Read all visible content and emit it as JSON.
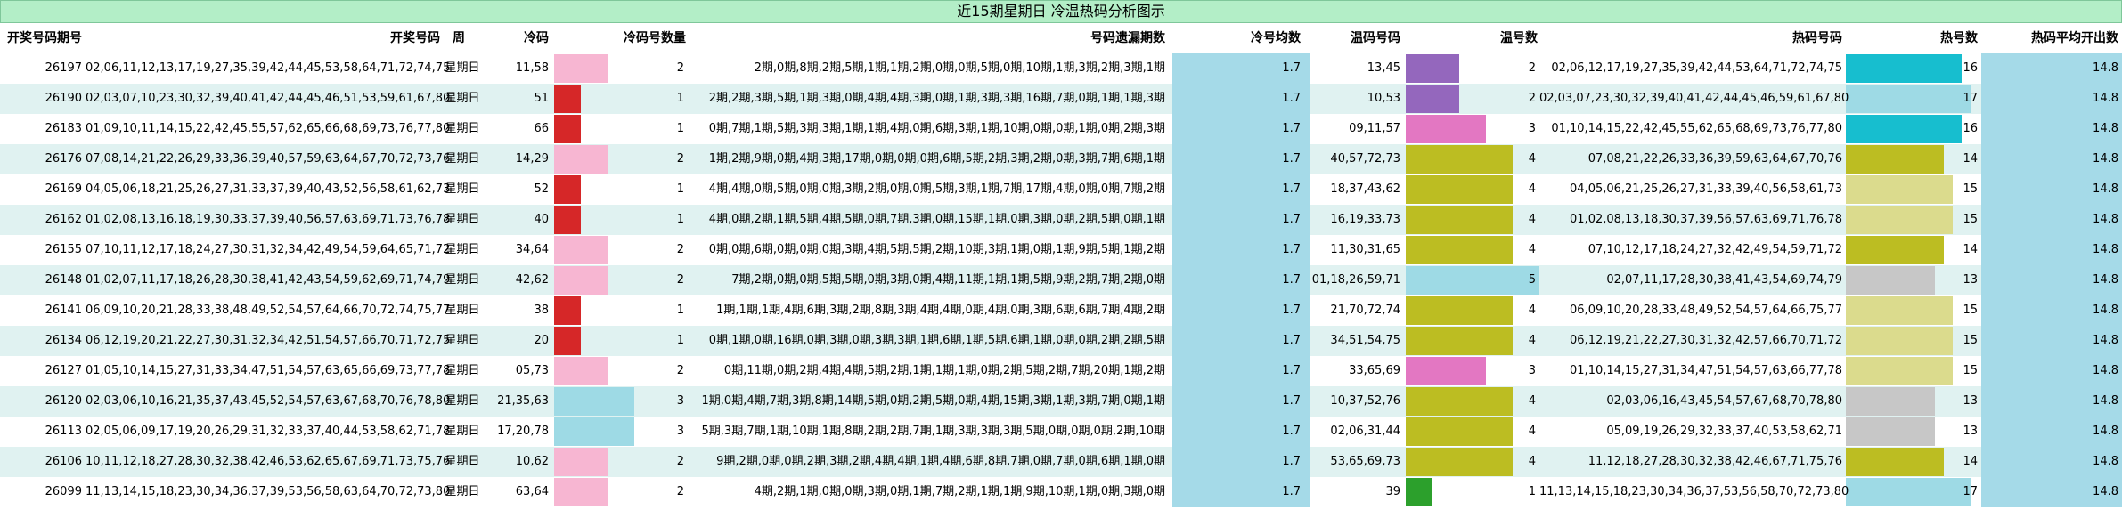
{
  "title": "近15期星期日 冷温热码分析图示",
  "headers": {
    "period": "开奖号码期号",
    "numbers": "开奖号码",
    "week": "周",
    "cold": "冷码",
    "cold_count": "冷码号数量",
    "missing": "号码遗漏期数",
    "cold_avg": "冷号均数",
    "warm": "温码号码",
    "warm_count": "温号数",
    "hot": "热码号码",
    "hot_count": "热号数",
    "hot_avg": "热码平均开出数"
  },
  "colors": {
    "title_bg": "#b3eec7",
    "row_alt": "#e0f2f1",
    "avg_block": "#a5dae8",
    "cold_1": "#d62728",
    "cold_2": "#f7b6d2",
    "cold_3": "#9edae5",
    "warm_1": "#2ca02c",
    "warm_2": "#9467bd",
    "warm_3": "#e377c2",
    "warm_4": "#bcbd22",
    "warm_5": "#9edae5",
    "hot_13": "#c7c7c7",
    "hot_14": "#bcbd22",
    "hot_15": "#dbdb8d",
    "hot_16": "#17becf",
    "hot_17": "#9edae5"
  },
  "rows": [
    {
      "period": "26197",
      "numbers": "02,06,11,12,13,17,19,27,35,39,42,44,45,53,58,64,71,72,74,75",
      "week": "星期日",
      "cold": "11,58",
      "cold_count": "2",
      "missing": "2期,0期,8期,2期,5期,1期,1期,2期,0期,0期,5期,0期,10期,1期,3期,2期,3期,1期",
      "cold_avg": "1.7",
      "warm": "13,45",
      "warm_count": "2",
      "hot": "02,06,12,17,19,27,35,39,42,44,53,64,71,72,74,75",
      "hot_count": "16",
      "hot_avg": "14.8"
    },
    {
      "period": "26190",
      "numbers": "02,03,07,10,23,30,32,39,40,41,42,44,45,46,51,53,59,61,67,80",
      "week": "星期日",
      "cold": "51",
      "cold_count": "1",
      "missing": "2期,2期,3期,5期,1期,3期,0期,4期,4期,3期,0期,1期,3期,3期,16期,7期,0期,1期,1期,3期",
      "cold_avg": "1.7",
      "warm": "10,53",
      "warm_count": "2",
      "hot": "02,03,07,23,30,32,39,40,41,42,44,45,46,59,61,67,80",
      "hot_count": "17",
      "hot_avg": "14.8"
    },
    {
      "period": "26183",
      "numbers": "01,09,10,11,14,15,22,42,45,55,57,62,65,66,68,69,73,76,77,80",
      "week": "星期日",
      "cold": "66",
      "cold_count": "1",
      "missing": "0期,7期,1期,5期,3期,3期,1期,1期,4期,0期,6期,3期,1期,10期,0期,0期,1期,0期,2期,3期",
      "cold_avg": "1.7",
      "warm": "09,11,57",
      "warm_count": "3",
      "hot": "01,10,14,15,22,42,45,55,62,65,68,69,73,76,77,80",
      "hot_count": "16",
      "hot_avg": "14.8"
    },
    {
      "period": "26176",
      "numbers": "07,08,14,21,22,26,29,33,36,39,40,57,59,63,64,67,70,72,73,76",
      "week": "星期日",
      "cold": "14,29",
      "cold_count": "2",
      "missing": "1期,2期,9期,0期,4期,3期,17期,0期,0期,0期,6期,5期,2期,3期,2期,0期,3期,7期,6期,1期",
      "cold_avg": "1.7",
      "warm": "40,57,72,73",
      "warm_count": "4",
      "hot": "07,08,21,22,26,33,36,39,59,63,64,67,70,76",
      "hot_count": "14",
      "hot_avg": "14.8"
    },
    {
      "period": "26169",
      "numbers": "04,05,06,18,21,25,26,27,31,33,37,39,40,43,52,56,58,61,62,73",
      "week": "星期日",
      "cold": "52",
      "cold_count": "1",
      "missing": "4期,4期,0期,5期,0期,0期,3期,2期,0期,0期,5期,3期,1期,7期,17期,4期,0期,0期,7期,2期",
      "cold_avg": "1.7",
      "warm": "18,37,43,62",
      "warm_count": "4",
      "hot": "04,05,06,21,25,26,27,31,33,39,40,56,58,61,73",
      "hot_count": "15",
      "hot_avg": "14.8"
    },
    {
      "period": "26162",
      "numbers": "01,02,08,13,16,18,19,30,33,37,39,40,56,57,63,69,71,73,76,78",
      "week": "星期日",
      "cold": "40",
      "cold_count": "1",
      "missing": "4期,0期,2期,1期,5期,4期,5期,0期,7期,3期,0期,15期,1期,0期,3期,0期,2期,5期,0期,1期",
      "cold_avg": "1.7",
      "warm": "16,19,33,73",
      "warm_count": "4",
      "hot": "01,02,08,13,18,30,37,39,56,57,63,69,71,76,78",
      "hot_count": "15",
      "hot_avg": "14.8"
    },
    {
      "period": "26155",
      "numbers": "07,10,11,12,17,18,24,27,30,31,32,34,42,49,54,59,64,65,71,72",
      "week": "星期日",
      "cold": "34,64",
      "cold_count": "2",
      "missing": "0期,0期,6期,0期,0期,0期,3期,4期,5期,5期,2期,10期,3期,1期,0期,1期,9期,5期,1期,2期",
      "cold_avg": "1.7",
      "warm": "11,30,31,65",
      "warm_count": "4",
      "hot": "07,10,12,17,18,24,27,32,42,49,54,59,71,72",
      "hot_count": "14",
      "hot_avg": "14.8"
    },
    {
      "period": "26148",
      "numbers": "01,02,07,11,17,18,26,28,30,38,41,42,43,54,59,62,69,71,74,79",
      "week": "星期日",
      "cold": "42,62",
      "cold_count": "2",
      "missing": "7期,2期,0期,0期,5期,5期,0期,3期,0期,4期,11期,1期,1期,5期,9期,2期,7期,2期,0期",
      "cold_avg": "1.7",
      "warm": "01,18,26,59,71",
      "warm_count": "5",
      "hot": "02,07,11,17,28,30,38,41,43,54,69,74,79",
      "hot_count": "13",
      "hot_avg": "14.8"
    },
    {
      "period": "26141",
      "numbers": "06,09,10,20,21,28,33,38,48,49,52,54,57,64,66,70,72,74,75,77",
      "week": "星期日",
      "cold": "38",
      "cold_count": "1",
      "missing": "1期,1期,1期,4期,6期,3期,2期,8期,3期,4期,4期,0期,4期,0期,3期,6期,6期,7期,4期,2期",
      "cold_avg": "1.7",
      "warm": "21,70,72,74",
      "warm_count": "4",
      "hot": "06,09,10,20,28,33,48,49,52,54,57,64,66,75,77",
      "hot_count": "15",
      "hot_avg": "14.8"
    },
    {
      "period": "26134",
      "numbers": "06,12,19,20,21,22,27,30,31,32,34,42,51,54,57,66,70,71,72,75",
      "week": "星期日",
      "cold": "20",
      "cold_count": "1",
      "missing": "0期,1期,0期,16期,0期,3期,0期,3期,3期,1期,6期,1期,5期,6期,1期,0期,0期,2期,2期,5期",
      "cold_avg": "1.7",
      "warm": "34,51,54,75",
      "warm_count": "4",
      "hot": "06,12,19,21,22,27,30,31,32,42,57,66,70,71,72",
      "hot_count": "15",
      "hot_avg": "14.8"
    },
    {
      "period": "26127",
      "numbers": "01,05,10,14,15,27,31,33,34,47,51,54,57,63,65,66,69,73,77,78",
      "week": "星期日",
      "cold": "05,73",
      "cold_count": "2",
      "missing": "0期,11期,0期,2期,4期,4期,5期,2期,1期,1期,1期,0期,2期,5期,2期,7期,20期,1期,2期",
      "cold_avg": "1.7",
      "warm": "33,65,69",
      "warm_count": "3",
      "hot": "01,10,14,15,27,31,34,47,51,54,57,63,66,77,78",
      "hot_count": "15",
      "hot_avg": "14.8"
    },
    {
      "period": "26120",
      "numbers": "02,03,06,10,16,21,35,37,43,45,52,54,57,63,67,68,70,76,78,80",
      "week": "星期日",
      "cold": "21,35,63",
      "cold_count": "3",
      "missing": "1期,0期,4期,7期,3期,8期,14期,5期,0期,2期,5期,0期,4期,15期,3期,1期,3期,7期,0期,1期",
      "cold_avg": "1.7",
      "warm": "10,37,52,76",
      "warm_count": "4",
      "hot": "02,03,06,16,43,45,54,57,67,68,70,78,80",
      "hot_count": "13",
      "hot_avg": "14.8"
    },
    {
      "period": "26113",
      "numbers": "02,05,06,09,17,19,20,26,29,31,32,33,37,40,44,53,58,62,71,78",
      "week": "星期日",
      "cold": "17,20,78",
      "cold_count": "3",
      "missing": "5期,3期,7期,1期,10期,1期,8期,2期,2期,7期,1期,3期,3期,3期,5期,0期,0期,0期,2期,10期",
      "cold_avg": "1.7",
      "warm": "02,06,31,44",
      "warm_count": "4",
      "hot": "05,09,19,26,29,32,33,37,40,53,58,62,71",
      "hot_count": "13",
      "hot_avg": "14.8"
    },
    {
      "period": "26106",
      "numbers": "10,11,12,18,27,28,30,32,38,42,46,53,62,65,67,69,71,73,75,76",
      "week": "星期日",
      "cold": "10,62",
      "cold_count": "2",
      "missing": "9期,2期,0期,0期,2期,3期,2期,4期,4期,1期,4期,6期,8期,7期,0期,7期,0期,6期,1期,0期",
      "cold_avg": "1.7",
      "warm": "53,65,69,73",
      "warm_count": "4",
      "hot": "11,12,18,27,28,30,32,38,42,46,67,71,75,76",
      "hot_count": "14",
      "hot_avg": "14.8"
    },
    {
      "period": "26099",
      "numbers": "11,13,14,15,18,23,30,34,36,37,39,53,56,58,63,64,70,72,73,80",
      "week": "星期日",
      "cold": "63,64",
      "cold_count": "2",
      "missing": "4期,2期,1期,0期,0期,3期,0期,1期,7期,2期,1期,1期,9期,10期,1期,0期,3期,0期",
      "cold_avg": "1.7",
      "warm": "39",
      "warm_count": "1",
      "hot": "11,13,14,15,18,23,30,34,36,37,53,56,58,70,72,73,80",
      "hot_count": "17",
      "hot_avg": "14.8"
    }
  ]
}
